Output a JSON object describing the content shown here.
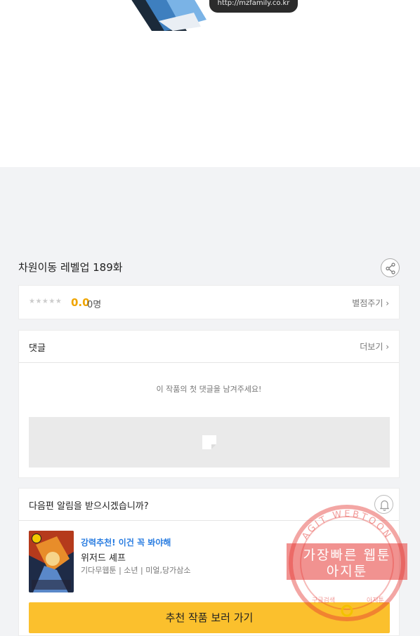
{
  "banner": {
    "url_text": "http://mzfamily.co.kr"
  },
  "episode": {
    "title": "차원이동 레벨업 189화"
  },
  "rating": {
    "stars": "★★★★★",
    "score": "0.0",
    "count": "0명",
    "rate_link": "별점주기 ›"
  },
  "comments": {
    "title": "댓글",
    "more": "더보기 ›",
    "empty_message": "이 작품의 첫 댓글을 남겨주세요!"
  },
  "notify": {
    "question": "다음편 알림을 받으시겠습니까?",
    "recommend_tag": "강력추천! 이건 꼭 봐야해",
    "recommend_title": "위저드 셰프",
    "recommend_meta": "기다무웹툰 | 소년 | 미얼,당가삼소",
    "button_label": "추천 작품 보러 가기"
  },
  "watermark": {
    "arc_text": "AGIT WEBTOON",
    "line1": "가장빠른 웹툰",
    "line2": "아지툰",
    "side_left": "구글검색",
    "side_right": "아지툰",
    "red": "#e53935"
  }
}
